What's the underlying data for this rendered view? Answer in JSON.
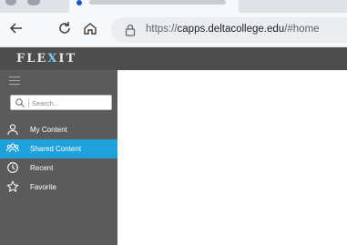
{
  "browser": {
    "url_prefix": "https://",
    "url_host": "capps.deltacollege.edu",
    "url_path": "/#home"
  },
  "app": {
    "logo_left": "FLE",
    "logo_x": "X",
    "logo_right": "IT"
  },
  "sidebar": {
    "search_placeholder": "Search...",
    "items": [
      {
        "label": "My Content",
        "icon": "user-icon",
        "active": false
      },
      {
        "label": "Shared Content",
        "icon": "users-icon",
        "active": true
      },
      {
        "label": "Recent",
        "icon": "clock-icon",
        "active": false
      },
      {
        "label": "Favorite",
        "icon": "star-icon",
        "active": false
      }
    ]
  },
  "colors": {
    "appbar": "#4d4d4d",
    "sidebar": "#5b5b5b",
    "active_item": "#1fa2db",
    "logo_accent": "#7fc6ee"
  }
}
